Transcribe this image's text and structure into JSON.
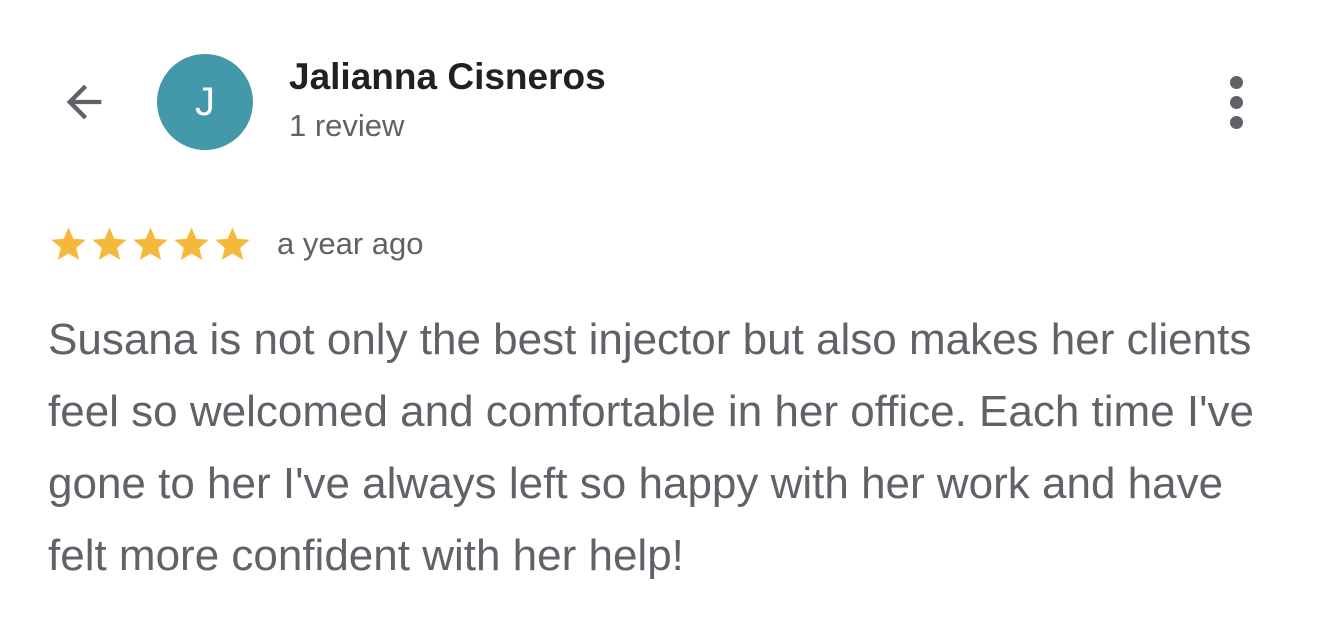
{
  "header": {
    "back_icon": "arrow-left-icon",
    "more_icon": "more-vert-icon"
  },
  "reviewer": {
    "avatar_letter": "J",
    "avatar_color": "#4398a9",
    "name": "Jalianna Cisneros",
    "review_count": "1 review"
  },
  "review": {
    "rating": 5,
    "max_rating": 5,
    "star_color": "#f4b93a",
    "time_ago": "a year ago",
    "text": "Susana is not only the best injector but also makes her clients feel so welcomed and comfortable in her office. Each time I've gone to her I've always left so happy with her work and have felt more confident with her help!"
  },
  "colors": {
    "primary_text": "#202124",
    "secondary_text": "#5f6368",
    "background": "#ffffff"
  }
}
